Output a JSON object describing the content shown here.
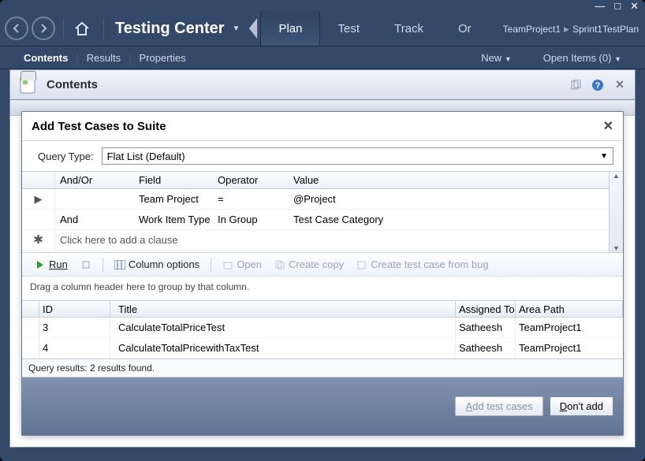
{
  "sysbuttons": {
    "min": "—",
    "max": "□",
    "close": "✕"
  },
  "app": {
    "title": "Testing Center",
    "tabs": [
      "Plan",
      "Test",
      "Track",
      "Or"
    ],
    "active_tab": 0
  },
  "breadcrumb": {
    "project": "TeamProject1",
    "plan": "Sprint1TestPlan"
  },
  "subnav": {
    "items": [
      "Contents",
      "Results",
      "Properties"
    ],
    "active": 0,
    "new_label": "New",
    "open_items": "Open Items (0)"
  },
  "panel": {
    "title": "Contents"
  },
  "dialog": {
    "title": "Add Test Cases to Suite",
    "query_type_label": "Query Type:",
    "query_type_value": "Flat List (Default)",
    "clause_headers": {
      "andor": "And/Or",
      "field": "Field",
      "operator": "Operator",
      "value": "Value"
    },
    "clauses": [
      {
        "andor": "",
        "field": "Team Project",
        "operator": "=",
        "value": "@Project"
      },
      {
        "andor": "And",
        "field": "Work Item Type",
        "operator": "In Group",
        "value": "Test Case Category"
      }
    ],
    "new_clause_placeholder": "Click here to add a clause",
    "toolbar": {
      "run": "Run",
      "column_options": "Column options",
      "open": "Open",
      "create_copy": "Create copy",
      "create_from_bug": "Create test case from bug"
    },
    "group_hint": "Drag a column header here to group by that column.",
    "result_headers": {
      "id": "ID",
      "title": "Title",
      "assigned": "Assigned To",
      "area": "Area Path"
    },
    "results": [
      {
        "id": "3",
        "title": "CalculateTotalPriceTest",
        "assigned": "Satheesh",
        "area": "TeamProject1"
      },
      {
        "id": "4",
        "title": "CalculateTotalPricewithTaxTest",
        "assigned": "Satheesh",
        "area": "TeamProject1"
      }
    ],
    "status": "Query results: 2 results found.",
    "buttons": {
      "add": "Add test cases",
      "add_u": "A",
      "dont": "Don't add",
      "dont_u": "D"
    }
  }
}
